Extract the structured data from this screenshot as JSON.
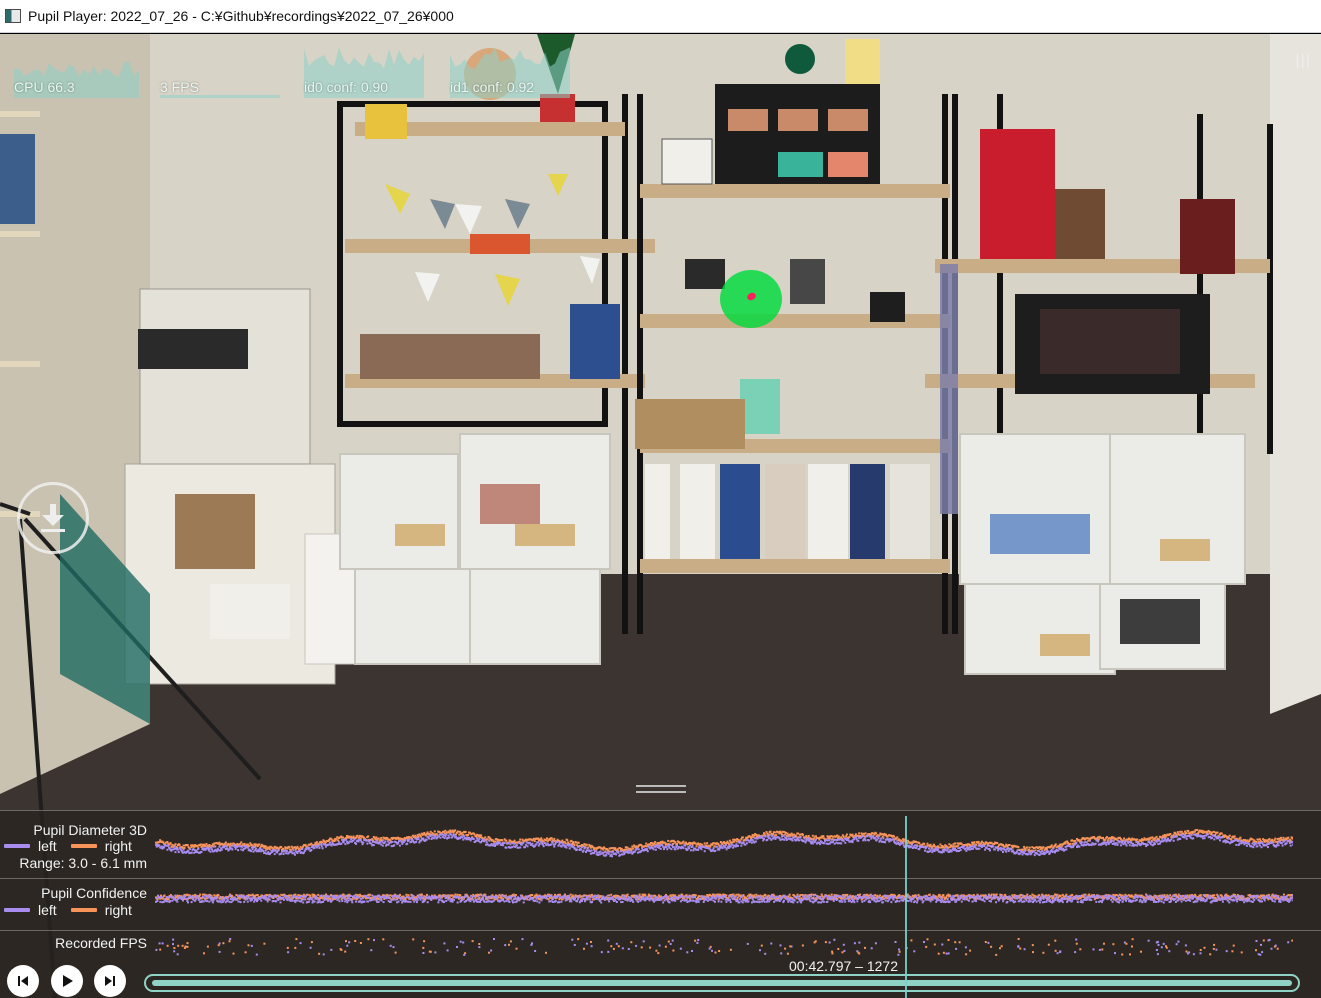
{
  "window": {
    "title": "Pupil Player: 2022_07_26 - C:¥Github¥recordings¥2022_07_26¥000"
  },
  "perf_graphs": [
    {
      "label": "CPU 66.3",
      "fill": 0.66
    },
    {
      "label": "3 FPS",
      "fill": 0.05
    },
    {
      "label": "id0 conf: 0.90",
      "fill": 0.9
    },
    {
      "label": "id1 conf: 0.92",
      "fill": 0.92
    }
  ],
  "menu_icon": "hamburger-icon",
  "download_icon": "download-icon",
  "timeline": {
    "pupil_diameter": {
      "title": "Pupil Diameter 3D",
      "left_label": "left",
      "right_label": "right",
      "range": "Range: 3.0 - 6.1 mm"
    },
    "pupil_confidence": {
      "title": "Pupil Confidence",
      "left_label": "left",
      "right_label": "right"
    },
    "recorded_fps": {
      "title": "Recorded FPS"
    },
    "time_readout": "00:42.797 – 1272",
    "playhead_fraction": 0.66,
    "colors": {
      "left": "#a88cf0",
      "right": "#f7945a",
      "accent": "#8fd3c6"
    }
  },
  "controls": {
    "prev_icon": "skip-previous-icon",
    "play_icon": "play-icon",
    "next_icon": "skip-next-icon"
  }
}
